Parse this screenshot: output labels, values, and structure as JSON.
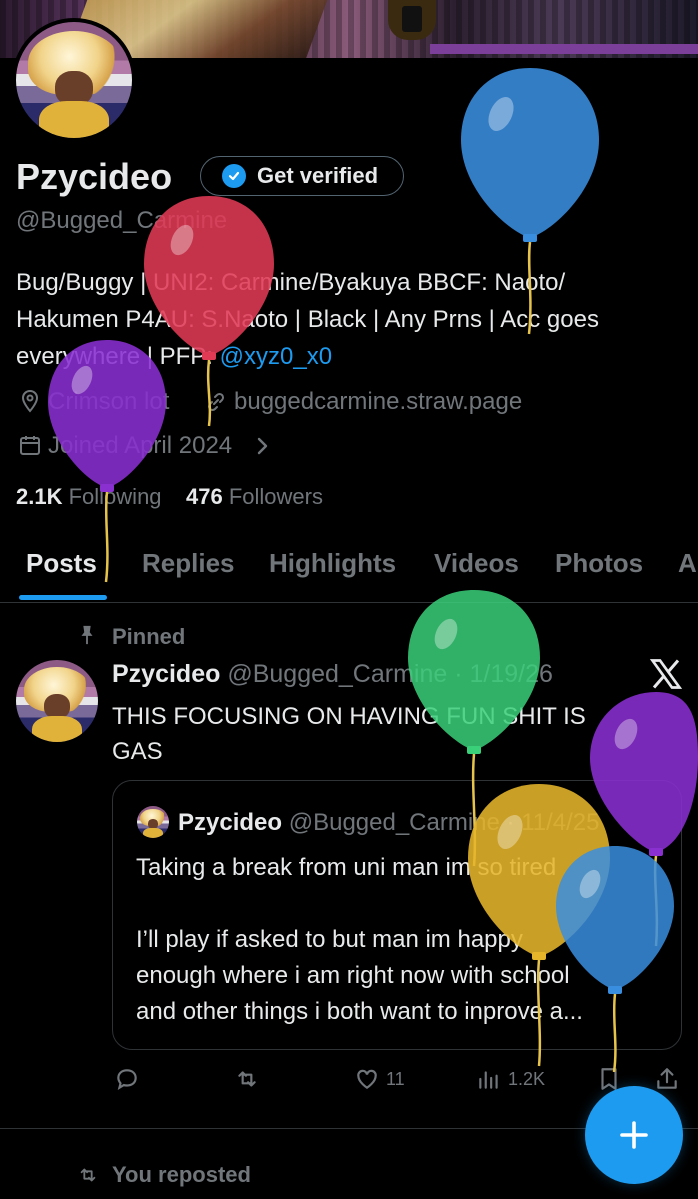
{
  "profile": {
    "display_name": "Pzycideo",
    "handle": "@Bugged_Carmine",
    "verify_button_label": "Get verified",
    "bio_lines": [
      "Bug/Buggy | UNI2: Carmine/Byakuya BBCF: Naoto/",
      "Hakumen P4AU: S.Naoto | Black | Any Prns | Acc goes",
      "everywhere | PFP: "
    ],
    "bio_mention": "@xyz0_x0",
    "location": "Crimson lot",
    "website": "buggedcarmine.straw.page",
    "joined": "Joined April 2024",
    "following_count": "2.1K",
    "following_label": "Following",
    "followers_count": "476",
    "followers_label": "Followers"
  },
  "tabs": [
    "Posts",
    "Replies",
    "Highlights",
    "Videos",
    "Photos",
    "A"
  ],
  "pinned_post": {
    "pinned_label": "Pinned",
    "author_name": "Pzycideo",
    "author_meta": "@Bugged_Carmine · 1/19/26",
    "text_lines": [
      "THIS FOCUSING ON HAVING FUN SHIT IS",
      "GAS"
    ],
    "quote": {
      "author_name": "Pzycideo",
      "author_meta": "@Bugged_Carmine · 11/4/25",
      "text_lines": [
        "Taking a break from uni man im so tired",
        "",
        "I’ll play if asked to but man im happy",
        "enough where i am right now with school",
        "and other things i both want to inprove a..."
      ]
    },
    "actions": {
      "replies": "",
      "reposts": "",
      "likes": "11",
      "views": "1.2K"
    }
  },
  "next_item": {
    "repost_label": "You reposted"
  },
  "icons": {
    "verify": "verified-badge-icon",
    "location": "location-pin-icon",
    "link": "link-icon",
    "calendar": "calendar-icon",
    "pin": "pin-icon",
    "platform": "x-logo-icon",
    "compose": "plus-icon"
  },
  "colors": {
    "background": "#000000",
    "text": "#e7e9ea",
    "muted": "#71767b",
    "accent": "#1d9bf0",
    "border": "#2f3336",
    "balloons": [
      "#e03a55",
      "#2e8fe0",
      "#8a2fd0",
      "#3ad07a",
      "#e6b52a",
      "#8a2fd0",
      "#2e8fe0"
    ]
  }
}
